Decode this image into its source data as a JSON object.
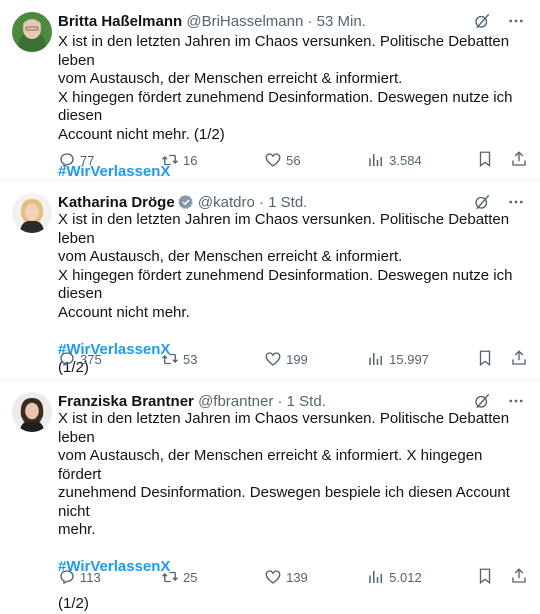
{
  "tweets": [
    {
      "name": "Britta Haßelmann",
      "handle": "@BriHasselmann",
      "separator": "·",
      "time": "53 Min.",
      "lines": [
        "X ist in den letzten Jahren im Chaos versunken. Politische Debatten leben",
        "vom Austausch, der Menschen erreicht & informiert.",
        "X hingegen fördert zunehmend Desinformation. Deswegen nutze ich diesen",
        "Account nicht mehr.  (1/2)"
      ],
      "hashtag": "#WirVerlassenX",
      "after": "",
      "replies": "77",
      "retweets": "16",
      "likes": "56",
      "views": "3.584"
    },
    {
      "name": "Katharina Dröge",
      "handle": "@katdro",
      "separator": "·",
      "time": "1 Std.",
      "verified": true,
      "lines": [
        "X ist in den letzten Jahren im Chaos versunken. Politische Debatten leben",
        "vom Austausch, der Menschen erreicht & informiert.",
        "X hingegen fördert zunehmend Desinformation. Deswegen nutze ich diesen",
        "Account nicht mehr."
      ],
      "hashtag": "#WirVerlassenX",
      "after": "(1/2)",
      "replies": "375",
      "retweets": "53",
      "likes": "199",
      "views": "15.997"
    },
    {
      "name": "Franziska Brantner",
      "handle": "@fbrantner",
      "separator": "·",
      "time": "1 Std.",
      "lines": [
        "X ist in den letzten Jahren im Chaos versunken. Politische Debatten leben",
        "vom Austausch, der Menschen erreicht & informiert. X hingegen fördert",
        "zunehmend Desinformation. Deswegen bespiele ich diesen Account nicht",
        "mehr."
      ],
      "hashtag": "#WirVerlassenX",
      "after": "(1/2)",
      "replies": "113",
      "retweets": "25",
      "likes": "139",
      "views": "5.012"
    }
  ],
  "icons": {
    "grok": "grok-icon",
    "more": "more-icon",
    "reply": "reply-icon",
    "retweet": "retweet-icon",
    "like": "like-icon",
    "views": "views-icon",
    "bookmark": "bookmark-icon",
    "share": "share-icon",
    "verified": "verified-badge-icon"
  },
  "colors": {
    "text": "#0f1419",
    "secondary": "#536471",
    "link": "#1d9bf0",
    "divider": "#eff3f4"
  }
}
